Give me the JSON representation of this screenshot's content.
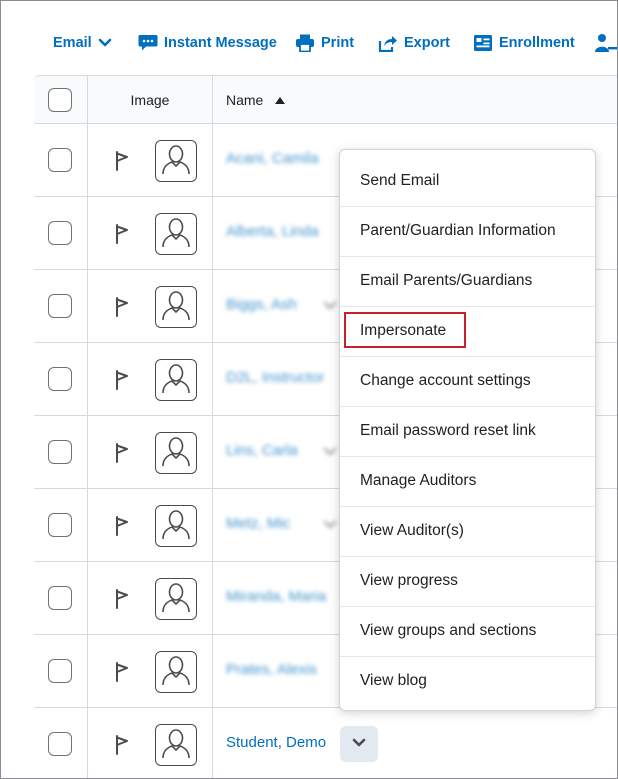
{
  "toolbar": {
    "email": "Email",
    "instant_message": "Instant Message",
    "print": "Print",
    "export": "Export",
    "enrollment": "Enrollment"
  },
  "table": {
    "header": {
      "image": "Image",
      "name": "Name"
    },
    "rows": [
      {
        "name": "Acani, Camila"
      },
      {
        "name": "Alberta, Linda"
      },
      {
        "name": "Biggs, Ash"
      },
      {
        "name": "D2L, Instructor"
      },
      {
        "name": "Lins, Carla"
      },
      {
        "name": "Metz, Mic"
      },
      {
        "name": "Miranda, Maria"
      },
      {
        "name": "Prates, Alexis"
      },
      {
        "name": "Student, Demo"
      }
    ]
  },
  "context_menu": {
    "items": [
      "Send Email",
      "Parent/Guardian Information",
      "Email Parents/Guardians",
      "Impersonate",
      "Change account settings",
      "Email password reset link",
      "Manage Auditors",
      "View Auditor(s)",
      "View progress",
      "View groups and sections",
      "View blog"
    ],
    "highlighted": "Impersonate"
  },
  "colors": {
    "link": "#006fbf",
    "highlight": "#c7202e",
    "border": "#d3d9e3"
  }
}
